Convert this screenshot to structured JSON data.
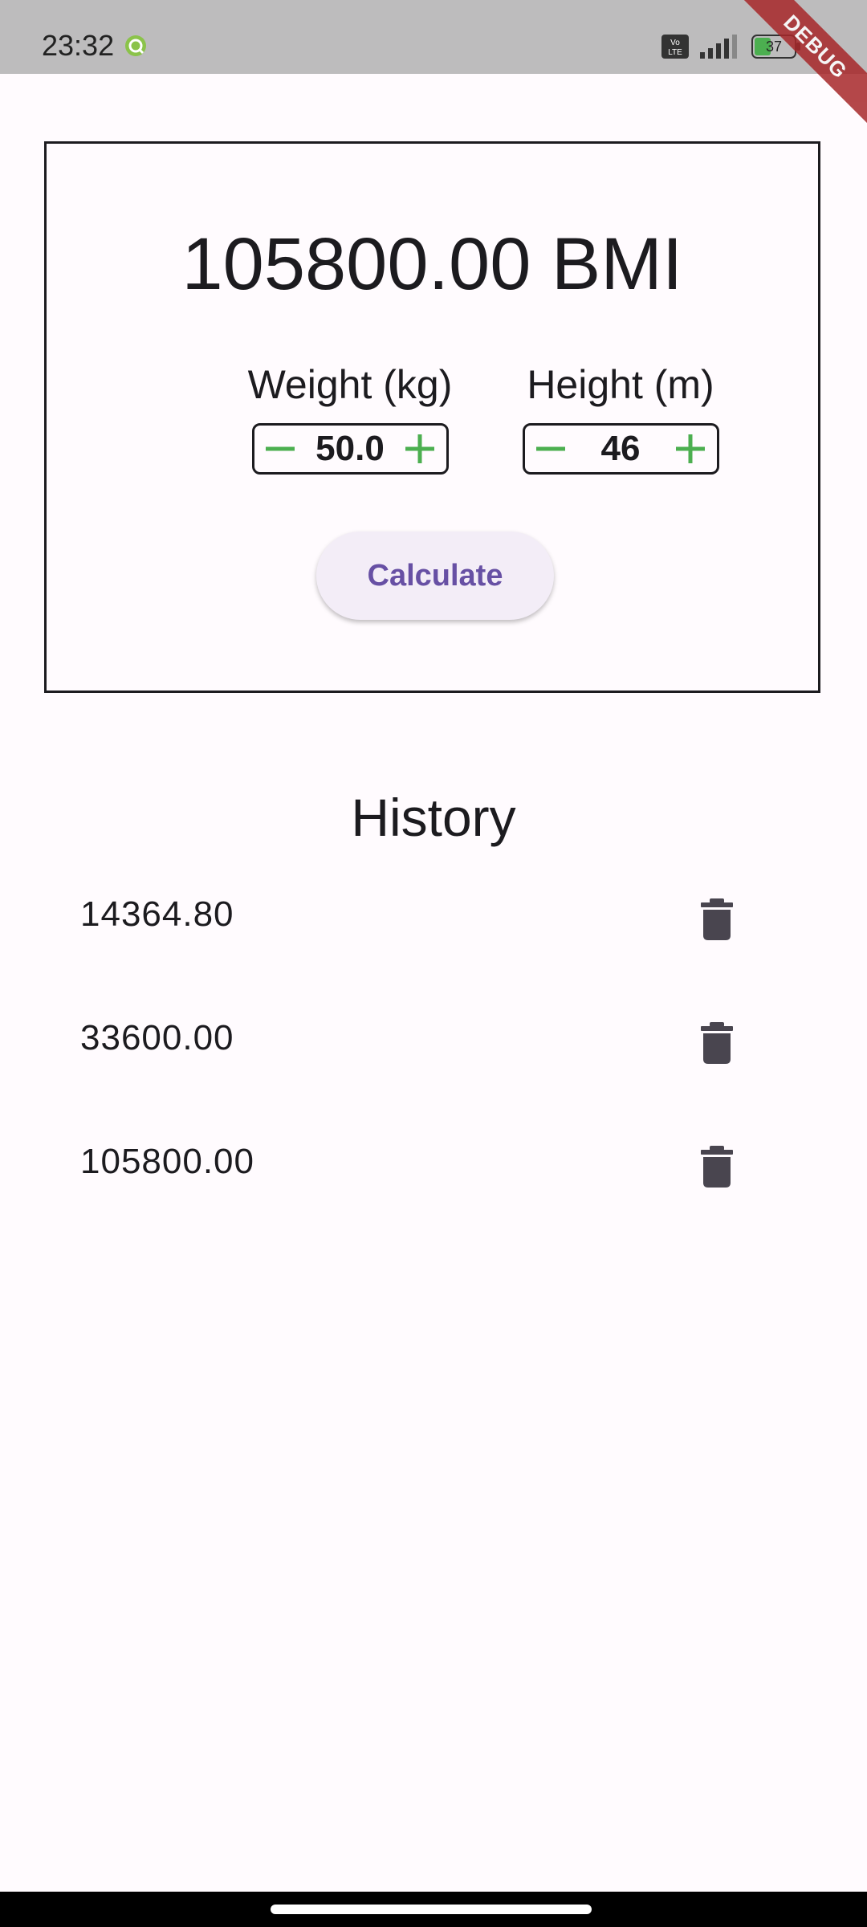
{
  "status_bar": {
    "time": "23:32",
    "network_label": "Vo LTE",
    "battery_level": "37"
  },
  "debug_banner": "DEBUG",
  "bmi": {
    "result": "105800.00 BMI",
    "weight": {
      "label": "Weight (kg)",
      "value": "50.0"
    },
    "height": {
      "label": "Height (m)",
      "value": "46"
    },
    "calculate_label": "Calculate"
  },
  "history": {
    "title": "History",
    "items": [
      {
        "value": "14364.80"
      },
      {
        "value": "33600.00"
      },
      {
        "value": "105800.00"
      }
    ]
  },
  "colors": {
    "background": "#fffbfe",
    "accent": "#6750a4",
    "stepper_icon": "#4caf50",
    "trash_icon": "#49454f",
    "debug": "#a7282a"
  }
}
